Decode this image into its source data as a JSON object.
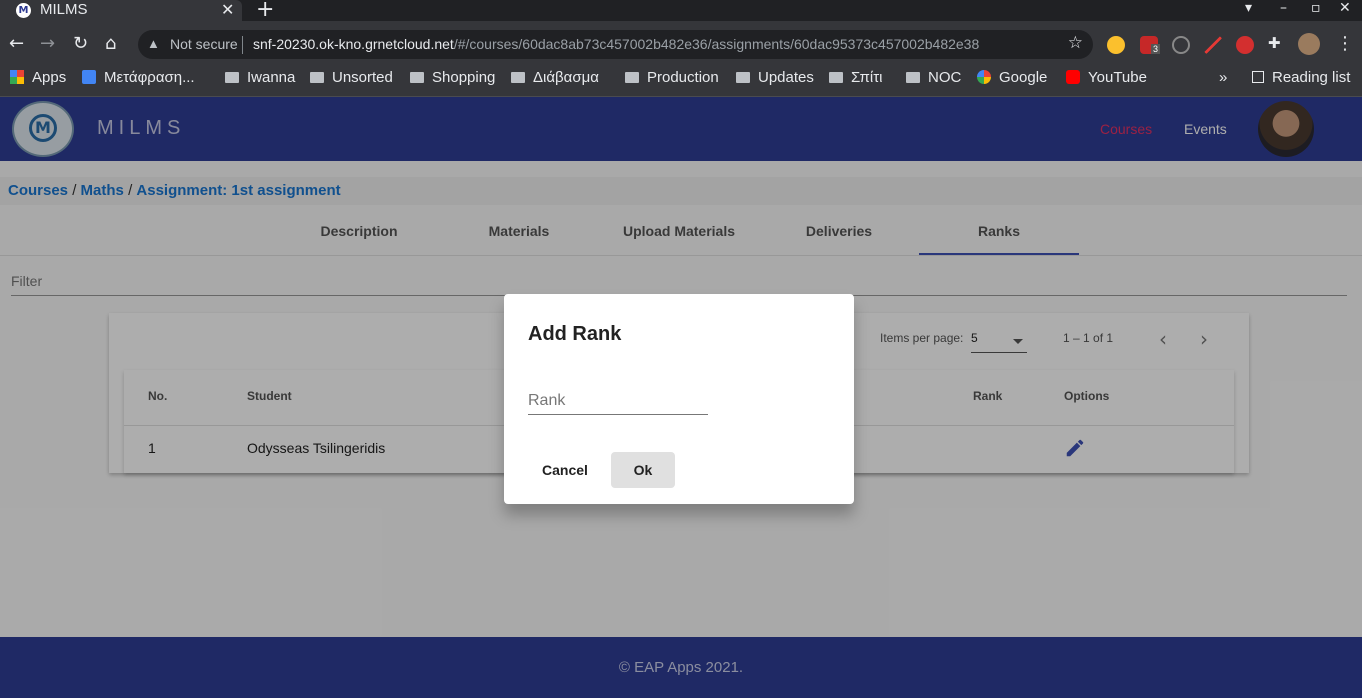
{
  "browser": {
    "tab_title": "MILMS",
    "tab_favicon": "M",
    "security": "Not secure",
    "url_host": "snf-20230.ok-kno.grnetcloud.net",
    "url_path": "/#/courses/60dac8ab73c457002b482e36/assignments/60dac95373c457002b482e38",
    "ext_badge": "3",
    "bookmarks": [
      "Apps",
      "Μετάφραση...",
      "Iwanna",
      "Unsorted",
      "Shopping",
      "Διάβασμα",
      "Production",
      "Updates",
      "Σπίτι",
      "NOC",
      "Google",
      "YouTube"
    ],
    "reading_list": "Reading list"
  },
  "header": {
    "brand": "MILMS",
    "logo_letter": "M",
    "nav": {
      "courses": "Courses",
      "events": "Events"
    }
  },
  "breadcrumb": {
    "courses": "Courses",
    "course": "Maths",
    "assignment": "Assignment: 1st assignment",
    "separator": "/"
  },
  "tabs": [
    "Description",
    "Materials",
    "Upload Materials",
    "Deliveries",
    "Ranks"
  ],
  "active_tab": "Ranks",
  "filter": {
    "placeholder": "Filter"
  },
  "table": {
    "items_per_page_label": "Items per page:",
    "items_per_page_value": "5",
    "range_label": "1 – 1 of 1",
    "columns": [
      "No.",
      "Student",
      "Rank",
      "Options"
    ],
    "rows": [
      {
        "no": "1",
        "student": "Odysseas Tsilingeridis",
        "rank": ""
      }
    ]
  },
  "dialog": {
    "title": "Add Rank",
    "input_placeholder": "Rank",
    "input_value": "",
    "cancel_label": "Cancel",
    "ok_label": "Ok"
  },
  "footer": {
    "text": "© EAP Apps 2021."
  },
  "colors": {
    "primary": "#2f3d95",
    "accent": "#e53164",
    "link": "#1976d2"
  }
}
